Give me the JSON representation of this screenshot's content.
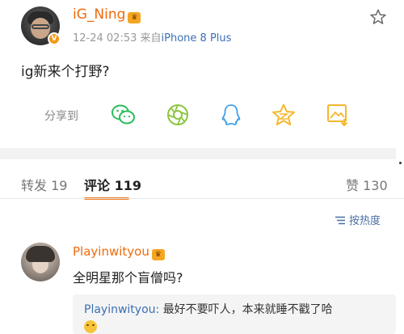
{
  "post": {
    "username": "iG_Ning",
    "timestamp": "12-24 02:53",
    "source_prefix": "来自",
    "device": "iPhone 8 Plus",
    "text": "ig新来个打野?",
    "verified_badge": "V"
  },
  "share": {
    "label": "分享到",
    "icons": [
      "wechat-icon",
      "moments-icon",
      "qq-icon",
      "qzone-icon",
      "save-image-icon"
    ]
  },
  "tabs": {
    "repost_label": "转发",
    "repost_count": "19",
    "comment_label": "评论",
    "comment_count": "119",
    "like_label": "赞",
    "like_count": "130"
  },
  "sort": {
    "label": "按热度"
  },
  "comment": {
    "username": "Playinwityou",
    "text": "全明星那个盲僧吗?",
    "reply": {
      "username": "Playinwityou:",
      "text": "最好不要吓人，本来就睡不戳了哈"
    }
  },
  "colors": {
    "username": "#f06b0c",
    "link_blue": "#3b6fb5",
    "tab_accent": "#f07c22",
    "wechat_green": "#2bbd5a",
    "qq_blue": "#3fa2e8",
    "qzone_yellow": "#f5b72c"
  }
}
